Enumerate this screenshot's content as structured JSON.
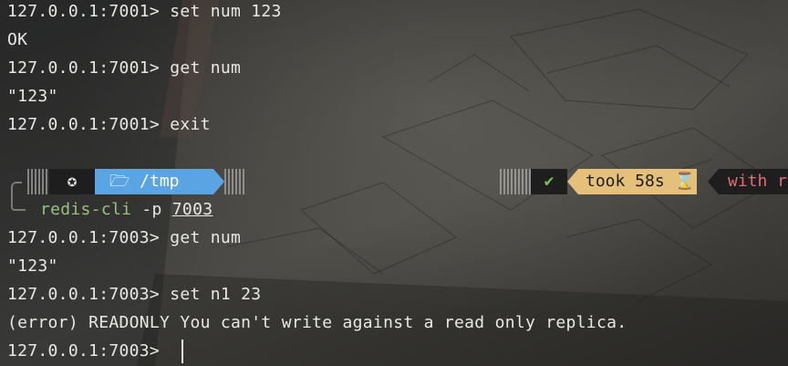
{
  "history": [
    {
      "text": "127.0.0.1:7001> set num 123"
    },
    {
      "text": "OK"
    },
    {
      "text": "127.0.0.1:7001> get num"
    },
    {
      "text": "\"123\""
    },
    {
      "text": "127.0.0.1:7001> exit"
    }
  ],
  "prompt": {
    "dir": "/tmp",
    "status_icon": "✔",
    "took": "took 58s",
    "hourglass": "⌛",
    "with": "with r",
    "colors": {
      "dir_bg": "#5aa4e4",
      "took_bg": "#e5c07b",
      "ok": "#7bbf5a",
      "with": "#e06c75",
      "cmd": "#98c379"
    }
  },
  "command": {
    "program": "redis-cli",
    "flag": "-p",
    "port": "7003"
  },
  "output": [
    {
      "text": "127.0.0.1:7003> get num"
    },
    {
      "text": "\"123\""
    },
    {
      "text": "127.0.0.1:7003> set n1 23"
    },
    {
      "text": "(error) READONLY You can't write against a read only replica."
    },
    {
      "text": "127.0.0.1:7003> "
    }
  ]
}
